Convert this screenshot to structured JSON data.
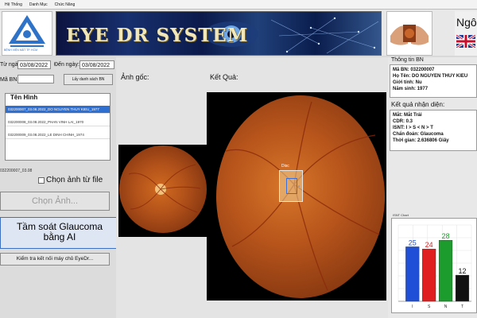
{
  "menu": {
    "items": [
      "Hệ Thống",
      "Danh Mục",
      "Chức Năng"
    ],
    "title": "EYE DR SYSTEM - Tầm soát"
  },
  "header": {
    "logo_caption": "BỆNH VIỆN MẮT TP. HCM",
    "banner_text": "EYE DR SYSTEM",
    "lang_label": "Ngô"
  },
  "left": {
    "from_label": "Từ ngày:",
    "from_value": "03/08/2022",
    "to_label": "Đến ngày:",
    "to_value": "03/08/2022",
    "patient_label": "Mã BN",
    "list_button": "Lấy danh sách BN",
    "list_header": "Tên Hình",
    "rows": [
      "032200007_03.08.2022_DO NGUYEN THUY KIEU_1977",
      "032200008_03.08.2022_PHAN VINH LAI_1970",
      "032200009_03.08.2022_LE DINH CHINH_1974"
    ],
    "status_text": "032200007_03.08",
    "file_checkbox": "Chọn ảnh từ file",
    "choose_button": "Chọn Ảnh...",
    "screen_button_line1": "Tầm soát Glaucoma",
    "screen_button_line2": "bằng AI",
    "connect_button": "Kiểm tra kết nối máy chủ EyeDr..."
  },
  "center": {
    "orig_label": "Ảnh gốc:",
    "result_label": "Kết Quả:",
    "roi_label": "Disc",
    "optic_marker": "-"
  },
  "info": {
    "title": "Thông tin BN",
    "patient": {
      "id_label": "Mã BN:",
      "id": "032200007",
      "name_label": "Họ Tên:",
      "name": "DO NGUYEN THUY KIEU",
      "gender_label": "Giới tính:",
      "gender": "Nu",
      "year_label": "Năm sinh:",
      "year": "1977"
    },
    "result_title": "Kết quả nhận diện:",
    "result": {
      "eye_label": "Mắt:",
      "eye": "Mắt Trái",
      "cdr_label": "CDR:",
      "cdr": "0.3",
      "isnt_label": "ISNT:",
      "isnt": "I > S < N > T",
      "diag_label": "Chẩn đoán:",
      "diag": "Glaucoma",
      "time_label": "Thời gian:",
      "time": "2.636806 Giây"
    },
    "chart_title": "ISNT Chart"
  },
  "chart_data": {
    "type": "bar",
    "categories": [
      "I",
      "S",
      "N",
      "T"
    ],
    "values": [
      25,
      24,
      28,
      12
    ],
    "colors": [
      "#1f4fd6",
      "#e02020",
      "#1c9c2c",
      "#111111"
    ],
    "ylim": [
      0,
      35
    ],
    "grid": true
  }
}
